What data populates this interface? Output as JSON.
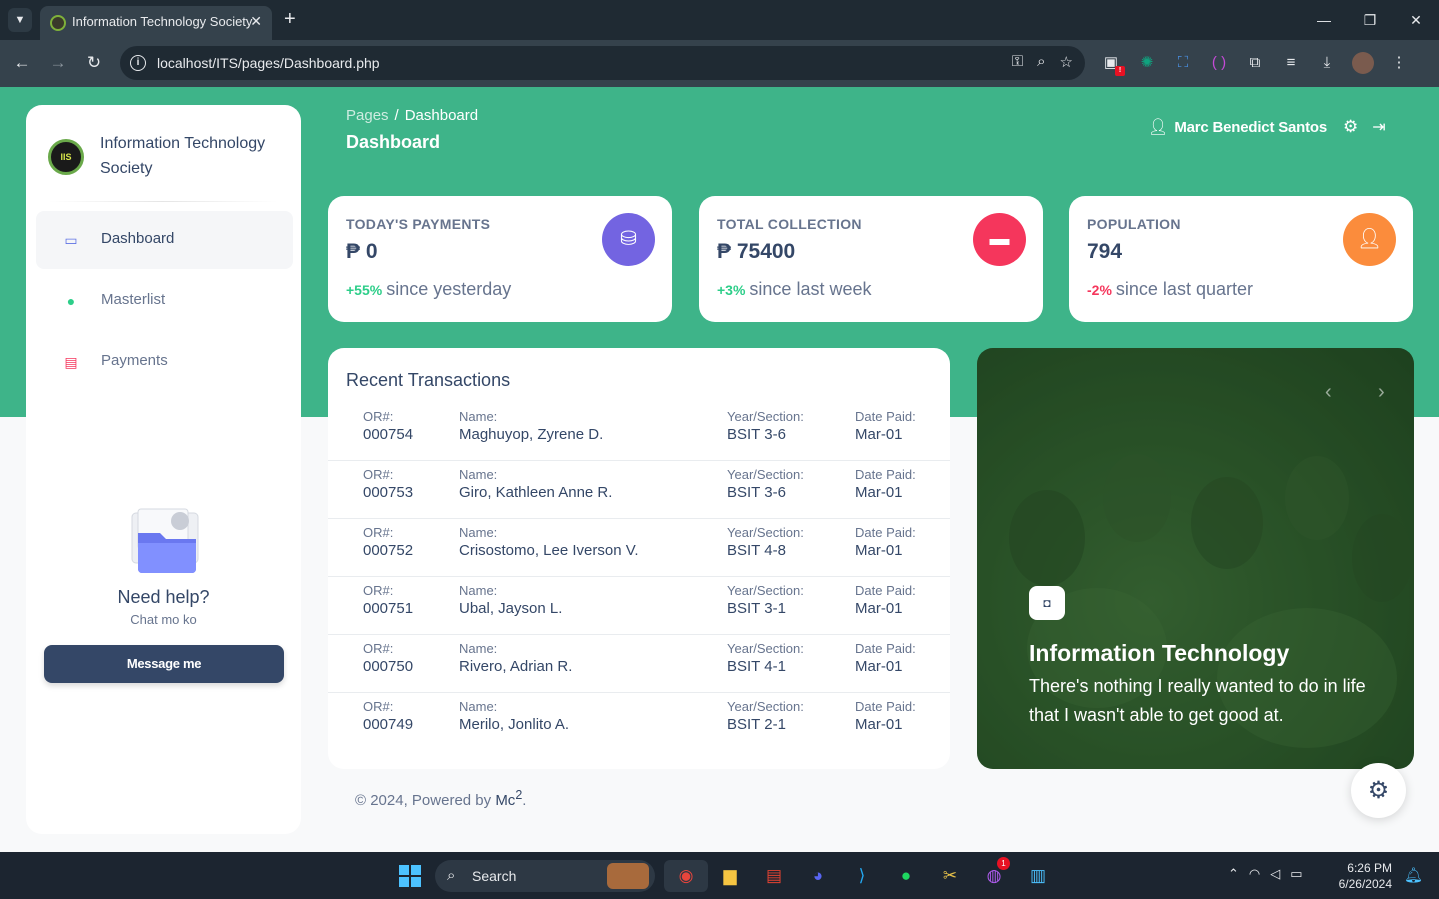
{
  "browser": {
    "tab_title": "Information Technology Society",
    "url": "localhost/ITS/pages/Dashboard.php",
    "tab_list_icon": "chevron-down-icon",
    "close_glyph": "✕",
    "new_tab_glyph": "+",
    "minimize_glyph": "—",
    "maximize_glyph": "❐",
    "window_close_glyph": "✕"
  },
  "sidebar": {
    "brand": "Information Technology Society",
    "logo_text": "IIS",
    "items": [
      {
        "label": "Dashboard",
        "icon": "monitor-icon",
        "color": "#344767"
      },
      {
        "label": "Masterlist",
        "icon": "user-icon",
        "color": "#2dce89"
      },
      {
        "label": "Payments",
        "icon": "document-icon",
        "color": "#f5365c"
      }
    ],
    "help_title": "Need help?",
    "help_subtitle": "Chat mo ko",
    "help_button": "Message me"
  },
  "header": {
    "breadcrumb_parent": "Pages",
    "breadcrumb_separator": "/",
    "breadcrumb_current": "Dashboard",
    "title": "Dashboard",
    "user_name": "Marc Benedict Santos"
  },
  "stats": [
    {
      "title": "TODAY'S PAYMENTS",
      "value": "₱ 0",
      "change": "+55%",
      "change_text": "since yesterday",
      "icon": "coins-icon",
      "color": "#7364e1"
    },
    {
      "title": "TOTAL COLLECTION",
      "value": "₱ 75400",
      "change": "+3%",
      "change_text": "since last week",
      "icon": "credit-card-icon",
      "color": "#f5365c"
    },
    {
      "title": "POPULATION",
      "value": "794",
      "change": "-2%",
      "change_text": "since last quarter",
      "icon": "user-icon",
      "color": "#fb8c3c"
    }
  ],
  "transactions": {
    "title": "Recent Transactions",
    "labels": {
      "or": "OR#:",
      "name": "Name:",
      "section": "Year/Section:",
      "date": "Date Paid:"
    },
    "rows": [
      {
        "or": "000754",
        "name": "Maghuyop, Zyrene D.",
        "section": "BSIT 3-6",
        "date": "Mar-01"
      },
      {
        "or": "000753",
        "name": "Giro, Kathleen Anne R.",
        "section": "BSIT 3-6",
        "date": "Mar-01"
      },
      {
        "or": "000752",
        "name": "Crisostomo, Lee Iverson V.",
        "section": "BSIT 4-8",
        "date": "Mar-01"
      },
      {
        "or": "000751",
        "name": "Ubal, Jayson L.",
        "section": "BSIT 3-1",
        "date": "Mar-01"
      },
      {
        "or": "000750",
        "name": "Rivero, Adrian R.",
        "section": "BSIT 4-1",
        "date": "Mar-01"
      },
      {
        "or": "000749",
        "name": "Merilo, Jonlito A.",
        "section": "BSIT 2-1",
        "date": "Mar-01"
      }
    ]
  },
  "carousel": {
    "title": "Information Technology",
    "description": "There's nothing I really wanted to do in life that I wasn't able to get good at."
  },
  "footer": {
    "text": "© 2024, Powered by",
    "brand": "Mc",
    "superscript": "2",
    "end": "."
  },
  "taskbar": {
    "search_label": "Search",
    "time": "6:26 PM",
    "date": "6/26/2024",
    "messenger_badge": "1",
    "extension_badge": "!"
  },
  "colors": {
    "accent_green": "#3eb489",
    "primary_text": "#344767",
    "muted_text": "#67748e"
  }
}
